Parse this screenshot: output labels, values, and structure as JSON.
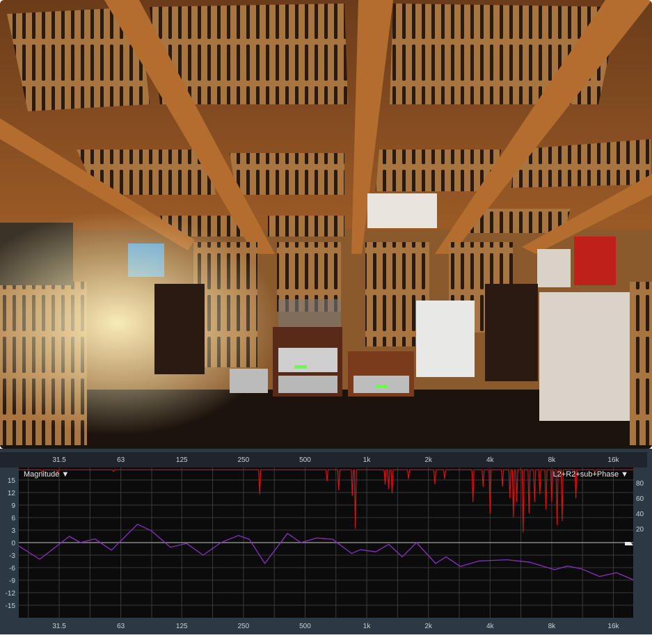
{
  "photo": {
    "subject": "listening room"
  },
  "chart_data": {
    "type": "line",
    "xscale": "log",
    "xlim": [
      20,
      20000
    ],
    "ylim": [
      -18,
      18
    ],
    "y2lim": [
      -96,
      100
    ],
    "x_ticks": [
      {
        "value": 31.5,
        "label": "31.5"
      },
      {
        "value": 63,
        "label": "63"
      },
      {
        "value": 125,
        "label": "125"
      },
      {
        "value": 250,
        "label": "250"
      },
      {
        "value": 500,
        "label": "500"
      },
      {
        "value": 1000,
        "label": "1k"
      },
      {
        "value": 2000,
        "label": "2k"
      },
      {
        "value": 4000,
        "label": "4k"
      },
      {
        "value": 8000,
        "label": "8k"
      },
      {
        "value": 16000,
        "label": "16k"
      }
    ],
    "y_ticks": [
      15,
      12,
      9,
      6,
      3,
      0,
      -3,
      -6,
      -9,
      -12,
      -15
    ],
    "y2_ticks": [
      80,
      60,
      40,
      20
    ],
    "left_legend": "Magnitude ▼",
    "right_legend": "L2+R2+sub+Phase ▼",
    "grid": true,
    "colors": {
      "magnitude": "#8a2fc0",
      "phase": "#e01010",
      "zero": "#8a8a8a",
      "grid": "#3a3a3a",
      "plot_bg": "#0b0b0b"
    },
    "series": [
      {
        "name": "Magnitude",
        "axis": "left",
        "points": [
          [
            20,
            -0.8
          ],
          [
            25.3,
            -4.0
          ],
          [
            35.3,
            1.5
          ],
          [
            40,
            0
          ],
          [
            47,
            0.9
          ],
          [
            56.7,
            -1.8
          ],
          [
            76,
            4.4
          ],
          [
            89,
            2.8
          ],
          [
            110,
            -1.1
          ],
          [
            132,
            -0.2
          ],
          [
            159,
            -3.0
          ],
          [
            194,
            0
          ],
          [
            236,
            1.7
          ],
          [
            267,
            0.8
          ],
          [
            318,
            -5.0
          ],
          [
            410,
            2.2
          ],
          [
            477,
            0
          ],
          [
            570,
            1.1
          ],
          [
            681,
            0.8
          ],
          [
            844,
            -2.6
          ],
          [
            931,
            -1.7
          ],
          [
            1108,
            -2.2
          ],
          [
            1280,
            -0.4
          ],
          [
            1490,
            -3.4
          ],
          [
            1750,
            0
          ],
          [
            2170,
            -5.0
          ],
          [
            2440,
            -3.4
          ],
          [
            2860,
            -5.7
          ],
          [
            3540,
            -4.4
          ],
          [
            4840,
            -4.1
          ],
          [
            6260,
            -4.7
          ],
          [
            8260,
            -6.5
          ],
          [
            9560,
            -5.6
          ],
          [
            11200,
            -6.3
          ],
          [
            13700,
            -8.1
          ],
          [
            16560,
            -7.2
          ],
          [
            20000,
            -8.9
          ]
        ]
      },
      {
        "name": "L2+R2+sub+Phase",
        "axis": "right",
        "baseline": 97,
        "dips": [
          [
            26,
            94
          ],
          [
            31,
            93
          ],
          [
            58,
            95
          ],
          [
            300,
            65
          ],
          [
            640,
            82
          ],
          [
            730,
            70
          ],
          [
            850,
            63
          ],
          [
            880,
            20
          ],
          [
            1230,
            78
          ],
          [
            1280,
            72
          ],
          [
            1330,
            66
          ],
          [
            1600,
            85
          ],
          [
            2150,
            78
          ],
          [
            2400,
            85
          ],
          [
            3300,
            55
          ],
          [
            3700,
            75
          ],
          [
            4000,
            40
          ],
          [
            4600,
            75
          ],
          [
            5000,
            60
          ],
          [
            5200,
            35
          ],
          [
            5400,
            55
          ],
          [
            5800,
            15
          ],
          [
            6200,
            40
          ],
          [
            6600,
            55
          ],
          [
            7000,
            65
          ],
          [
            7500,
            45
          ],
          [
            8000,
            55
          ],
          [
            8500,
            25
          ],
          [
            9000,
            30
          ],
          [
            10500,
            60
          ],
          [
            13000,
            92
          ]
        ]
      }
    ]
  }
}
